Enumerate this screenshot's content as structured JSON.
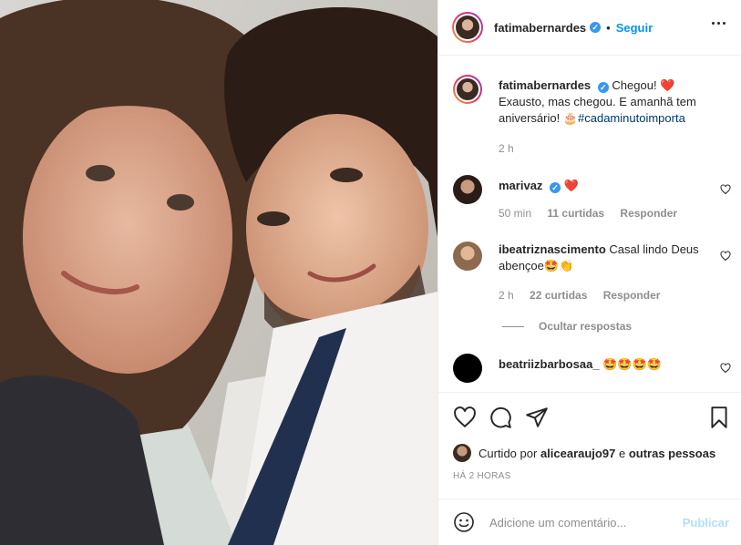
{
  "post": {
    "username": "fatimabernardes",
    "follow_label": "Seguir",
    "dot": "•",
    "caption_username": "fatimabernardes",
    "caption_text": "Chegou! ❤️ Exausto, mas chegou. E amanhã tem aniversário!",
    "caption_emoji": "🎂",
    "caption_hashtag": "#cadaminutoimporta",
    "caption_age": "2 h"
  },
  "comments": [
    {
      "username": "marivaz",
      "text": "❤️",
      "age": "50 min",
      "likes": "11 curtidas",
      "reply": "Responder"
    },
    {
      "username": "ibeatriznascimento",
      "text": "Casal lindo Deus abençoe🤩👏",
      "age": "2 h",
      "likes": "22 curtidas",
      "reply": "Responder"
    },
    {
      "username": "beatriizbarbosaa_",
      "text": "🤩🤩🤩🤩"
    }
  ],
  "hide_replies": "Ocultar respostas",
  "liked_by": {
    "prefix": "Curtido por",
    "user": "alicearaujo97",
    "middle": "e",
    "others": "outras pessoas"
  },
  "timestamp": "HÁ 2 HORAS",
  "composer": {
    "placeholder": "Adicione um comentário...",
    "publish": "Publicar"
  },
  "icons": [
    "heart-icon",
    "comment-icon",
    "share-icon",
    "bookmark-icon",
    "emoji-icon",
    "more-options-icon",
    "verified-icon"
  ],
  "colors": {
    "accent": "#0095f6",
    "verified": "#3897f0",
    "publish_disabled": "#b2dffc",
    "heart": "#ed4956"
  }
}
